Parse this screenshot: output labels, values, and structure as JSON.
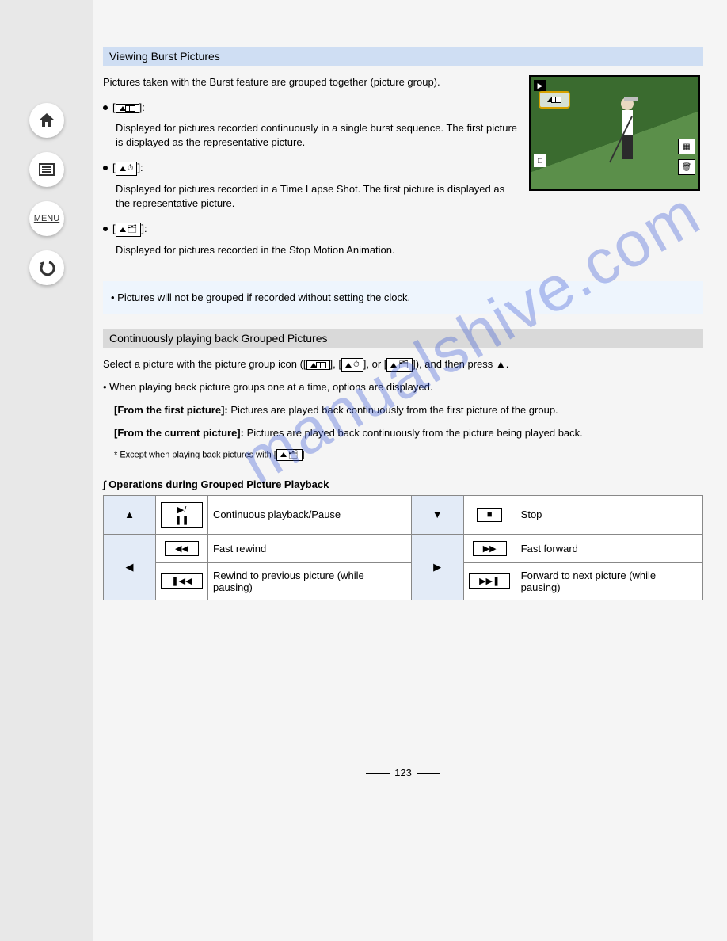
{
  "sidebar": {
    "home": "home-icon",
    "toc": "toc-icon",
    "menu_label": "MENU",
    "back": "back-icon"
  },
  "section_top": {
    "heading": "Viewing Burst Pictures",
    "intro": "Pictures taken with the Burst feature are grouped together (picture group).",
    "items": [
      {
        "icon": "burst-group-icon",
        "text": "Displayed for pictures recorded continuously in a single burst sequence. The first picture is displayed as the representative picture."
      },
      {
        "icon": "timelapse-group-icon",
        "text": "Displayed for pictures recorded in a Time Lapse Shot. The first picture is displayed as the representative picture."
      },
      {
        "icon": "stopmotion-group-icon",
        "text": "Displayed for pictures recorded in the Stop Motion Animation."
      }
    ],
    "note": "Pictures will not be grouped if recorded without setting the clock."
  },
  "section_mid": {
    "heading": "Continuously playing back Grouped Pictures",
    "para_prefix": "Select a picture with the picture group icon ([",
    "para_mid": "], [",
    "para_mid2": "], or [",
    "para_suffix": "]), and then press ",
    "arrow_word": "▲",
    "step1_prefix": "When playing back picture groups one at a time, options are displayed.",
    "step1_bold": "[From the first picture]:",
    "step1_text": " Pictures are played back continuously from the first picture of the group.",
    "step2_bold": "[From the current picture]:",
    "step2_text": " Pictures are played back continuously from the picture being played back.",
    "note_small": "* Except when playing back pictures with [",
    "note_small_end": "]"
  },
  "ops": {
    "heading": "Operations during Grouped Picture Playback",
    "rows": [
      {
        "lefthdr": "▲",
        "lefticon": "play-pause",
        "lefttext": "Continuous playback/Pause",
        "righthdr": "▼",
        "righticon": "stop",
        "righttext": "Stop"
      },
      {
        "lefthdr": "◀",
        "lefticon": "rewind",
        "lefttext": "Fast rewind",
        "righthdr": "▶",
        "righticon": "ffwd",
        "righttext": "Fast forward"
      },
      {
        "lefthdr": "◀",
        "lefticon": "prev",
        "lefttext": "Rewind to previous picture (while pausing)",
        "righthdr": "▶",
        "righticon": "next",
        "righttext": "Forward to next picture (while pausing)"
      }
    ]
  },
  "page_number": "123",
  "watermark": "manualshive.com"
}
